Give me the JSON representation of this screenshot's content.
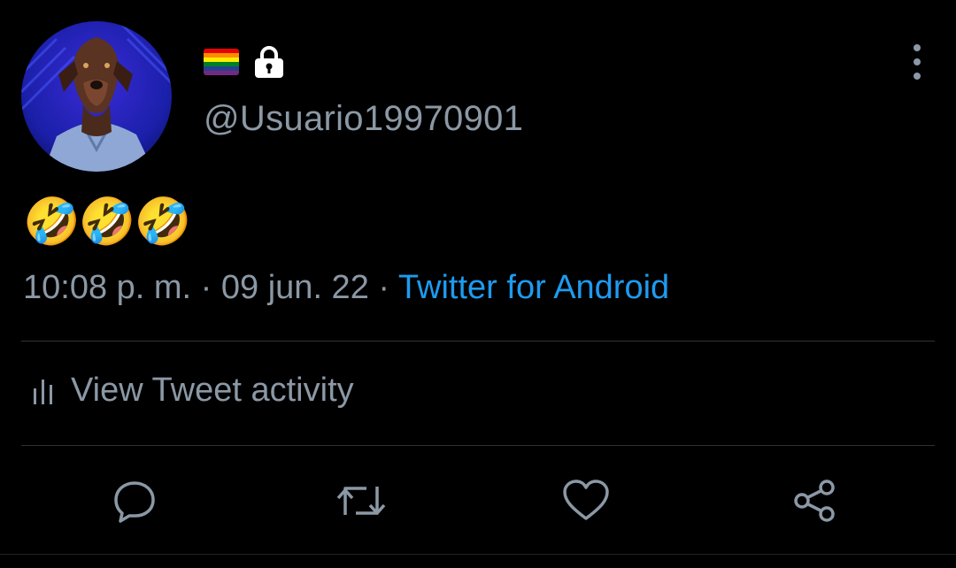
{
  "user": {
    "handle": "@Usuario19970901",
    "badges": [
      "rainbow-flag-icon",
      "lock-icon"
    ]
  },
  "tweet": {
    "text": "🤣🤣🤣",
    "time": "10:08 p. m.",
    "separator": " · ",
    "date": "09 jun. 22",
    "source": "Twitter for Android"
  },
  "activity": {
    "label": "View Tweet activity"
  },
  "actions": [
    "reply-icon",
    "retweet-icon",
    "like-icon",
    "share-icon"
  ],
  "colors": {
    "background": "#000000",
    "secondary_text": "#8b98a5",
    "link": "#1d9bf0",
    "divider": "#2f3336"
  }
}
